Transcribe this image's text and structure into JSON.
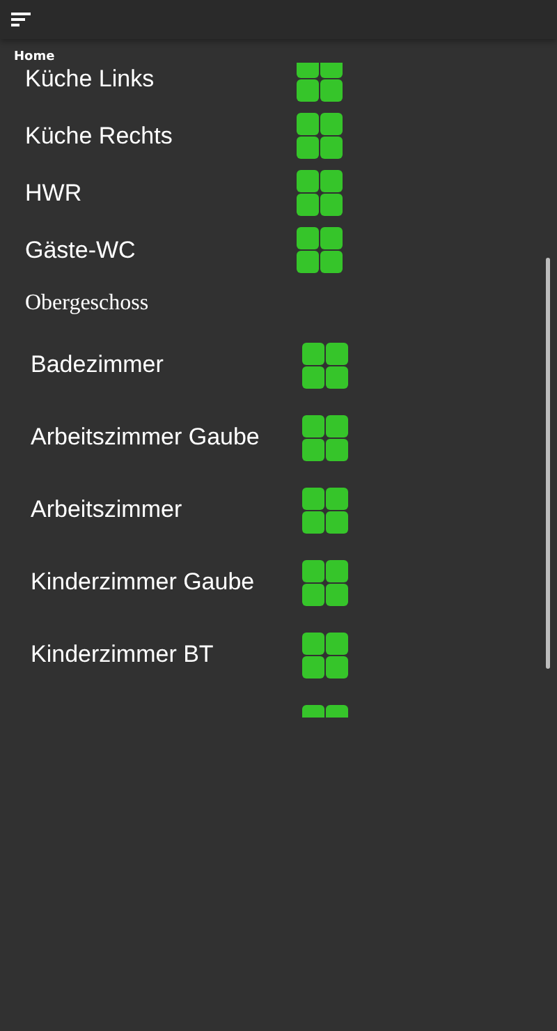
{
  "header": {
    "title": "Home"
  },
  "floors": [
    {
      "rooms": [
        {
          "kind": "room",
          "name": "Küche Links"
        },
        {
          "kind": "room",
          "name": "Küche Rechts"
        },
        {
          "kind": "room",
          "name": "HWR"
        },
        {
          "kind": "room",
          "name": "Gäste-WC"
        }
      ]
    },
    {
      "title": "Obergeschoss",
      "rooms": [
        {
          "kind": "room",
          "name": "Badezimmer"
        },
        {
          "kind": "room",
          "name": "Arbeitszimmer Gaube"
        },
        {
          "kind": "room",
          "name": "Arbeitszimmer"
        },
        {
          "kind": "room",
          "name": "Kinderzimmer Gaube"
        },
        {
          "kind": "room",
          "name": "Kinderzimmer BT"
        },
        {
          "kind": "icon-only"
        }
      ]
    }
  ]
}
